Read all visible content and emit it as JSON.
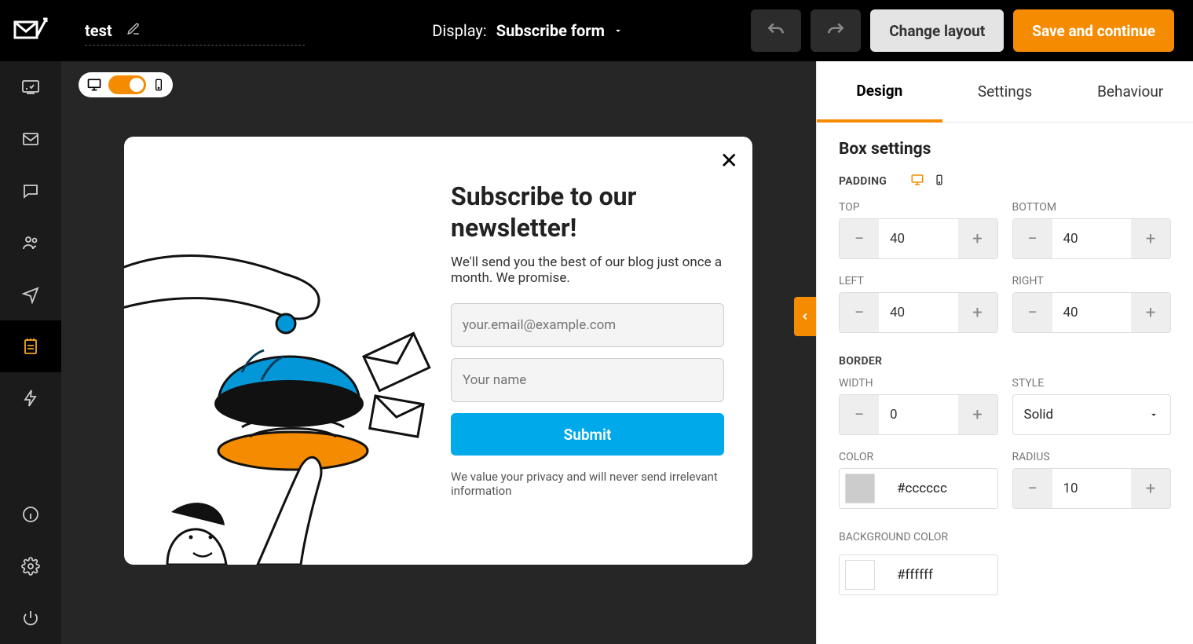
{
  "brand_icon": "logo",
  "rail": {
    "items": [
      "dashboard",
      "mail",
      "chat",
      "users",
      "send",
      "notes",
      "zap",
      "info",
      "settings",
      "power"
    ],
    "active_index": 5
  },
  "header": {
    "title": "test",
    "display_label": "Display:",
    "display_value": "Subscribe form",
    "change_layout": "Change layout",
    "save_continue": "Save and continue"
  },
  "canvas": {
    "device_toggle": true
  },
  "popup": {
    "title": "Subscribe to our newsletter!",
    "subtitle": "We'll send you the best of our blog just once a month. We promise.",
    "email_placeholder": "your.email@example.com",
    "name_placeholder": "Your name",
    "submit_label": "Submit",
    "privacy": "We value your privacy and will never send irrelevant information"
  },
  "sidepanel": {
    "tabs": {
      "design": "Design",
      "settings": "Settings",
      "behaviour": "Behaviour"
    },
    "active_tab": "design",
    "box_heading": "Box settings",
    "padding_label": "PADDING",
    "padding": {
      "top_label": "TOP",
      "bottom_label": "BOTTOM",
      "left_label": "LEFT",
      "right_label": "RIGHT",
      "top": "40",
      "bottom": "40",
      "left": "40",
      "right": "40"
    },
    "border_label": "BORDER",
    "border": {
      "width_label": "WIDTH",
      "width": "0",
      "style_label": "STYLE",
      "style": "Solid",
      "color_label": "COLOR",
      "color": "#cccccc",
      "radius_label": "RADIUS",
      "radius": "10"
    },
    "bg_label": "BACKGROUND COLOR",
    "bg_color": "#ffffff"
  },
  "colors": {
    "orange": "#f58b00",
    "blue": "#00aaea"
  }
}
